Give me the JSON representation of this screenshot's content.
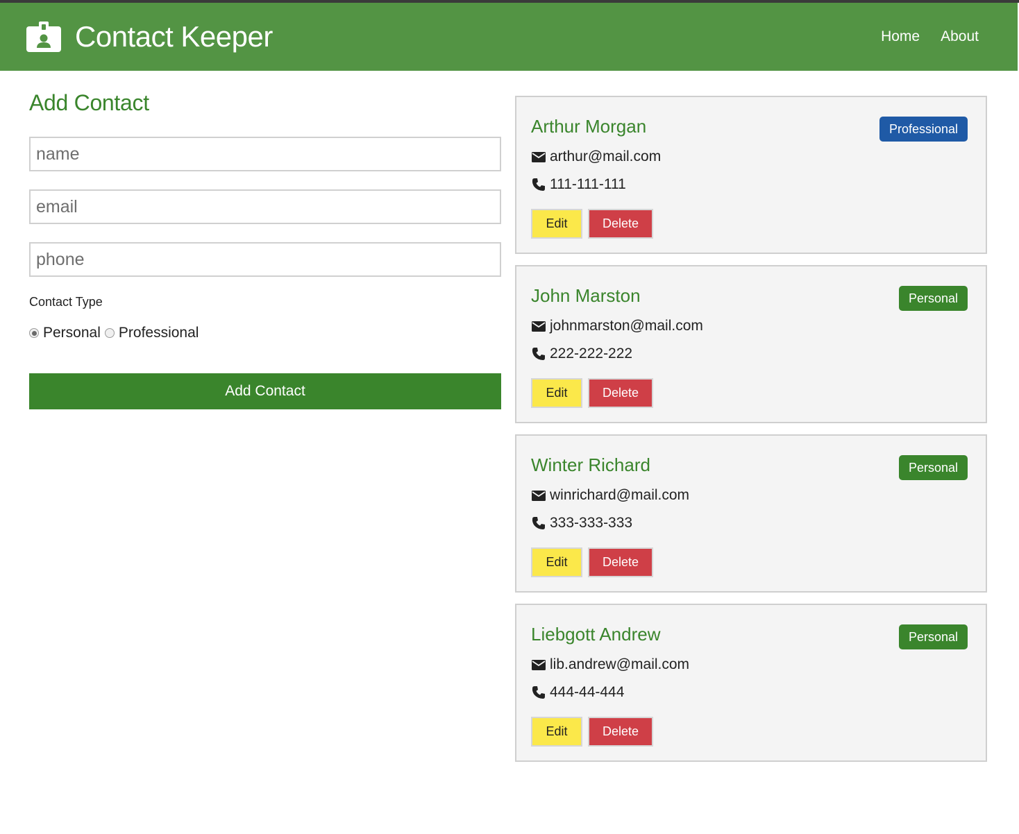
{
  "navbar": {
    "title": "Contact Keeper",
    "brand_icon": "id-badge-icon",
    "links": [
      {
        "label": "Home"
      },
      {
        "label": "About"
      }
    ]
  },
  "form": {
    "title": "Add Contact",
    "fields": {
      "name": {
        "placeholder": "name",
        "value": ""
      },
      "email": {
        "placeholder": "email",
        "value": ""
      },
      "phone": {
        "placeholder": "phone",
        "value": ""
      }
    },
    "type_label": "Contact Type",
    "radio_options": [
      {
        "label": "Personal",
        "checked": true
      },
      {
        "label": "Professional",
        "checked": false
      }
    ],
    "submit_label": "Add Contact"
  },
  "contacts": [
    {
      "name": "Arthur Morgan",
      "type": "Professional",
      "email": "arthur@mail.com",
      "phone": "111-111-111",
      "edit_label": "Edit",
      "delete_label": "Delete"
    },
    {
      "name": "John Marston",
      "type": "Personal",
      "email": "johnmarston@mail.com",
      "phone": "222-222-222",
      "edit_label": "Edit",
      "delete_label": "Delete"
    },
    {
      "name": "Winter Richard",
      "type": "Personal",
      "email": "winrichard@mail.com",
      "phone": "333-333-333",
      "edit_label": "Edit",
      "delete_label": "Delete"
    },
    {
      "name": "Liebgott Andrew",
      "type": "Personal",
      "email": "lib.andrew@mail.com",
      "phone": "444-44-444",
      "edit_label": "Edit",
      "delete_label": "Delete"
    }
  ],
  "colors": {
    "navbar": "#539444",
    "primary": "#3a852c",
    "professional_badge": "#1f5aa6",
    "personal_badge": "#3a852c",
    "edit_button": "#fbe84a",
    "delete_button": "#cf3f47",
    "card_background": "#f4f4f4"
  },
  "icons": {
    "email": "envelope-icon",
    "phone": "phone-icon"
  }
}
